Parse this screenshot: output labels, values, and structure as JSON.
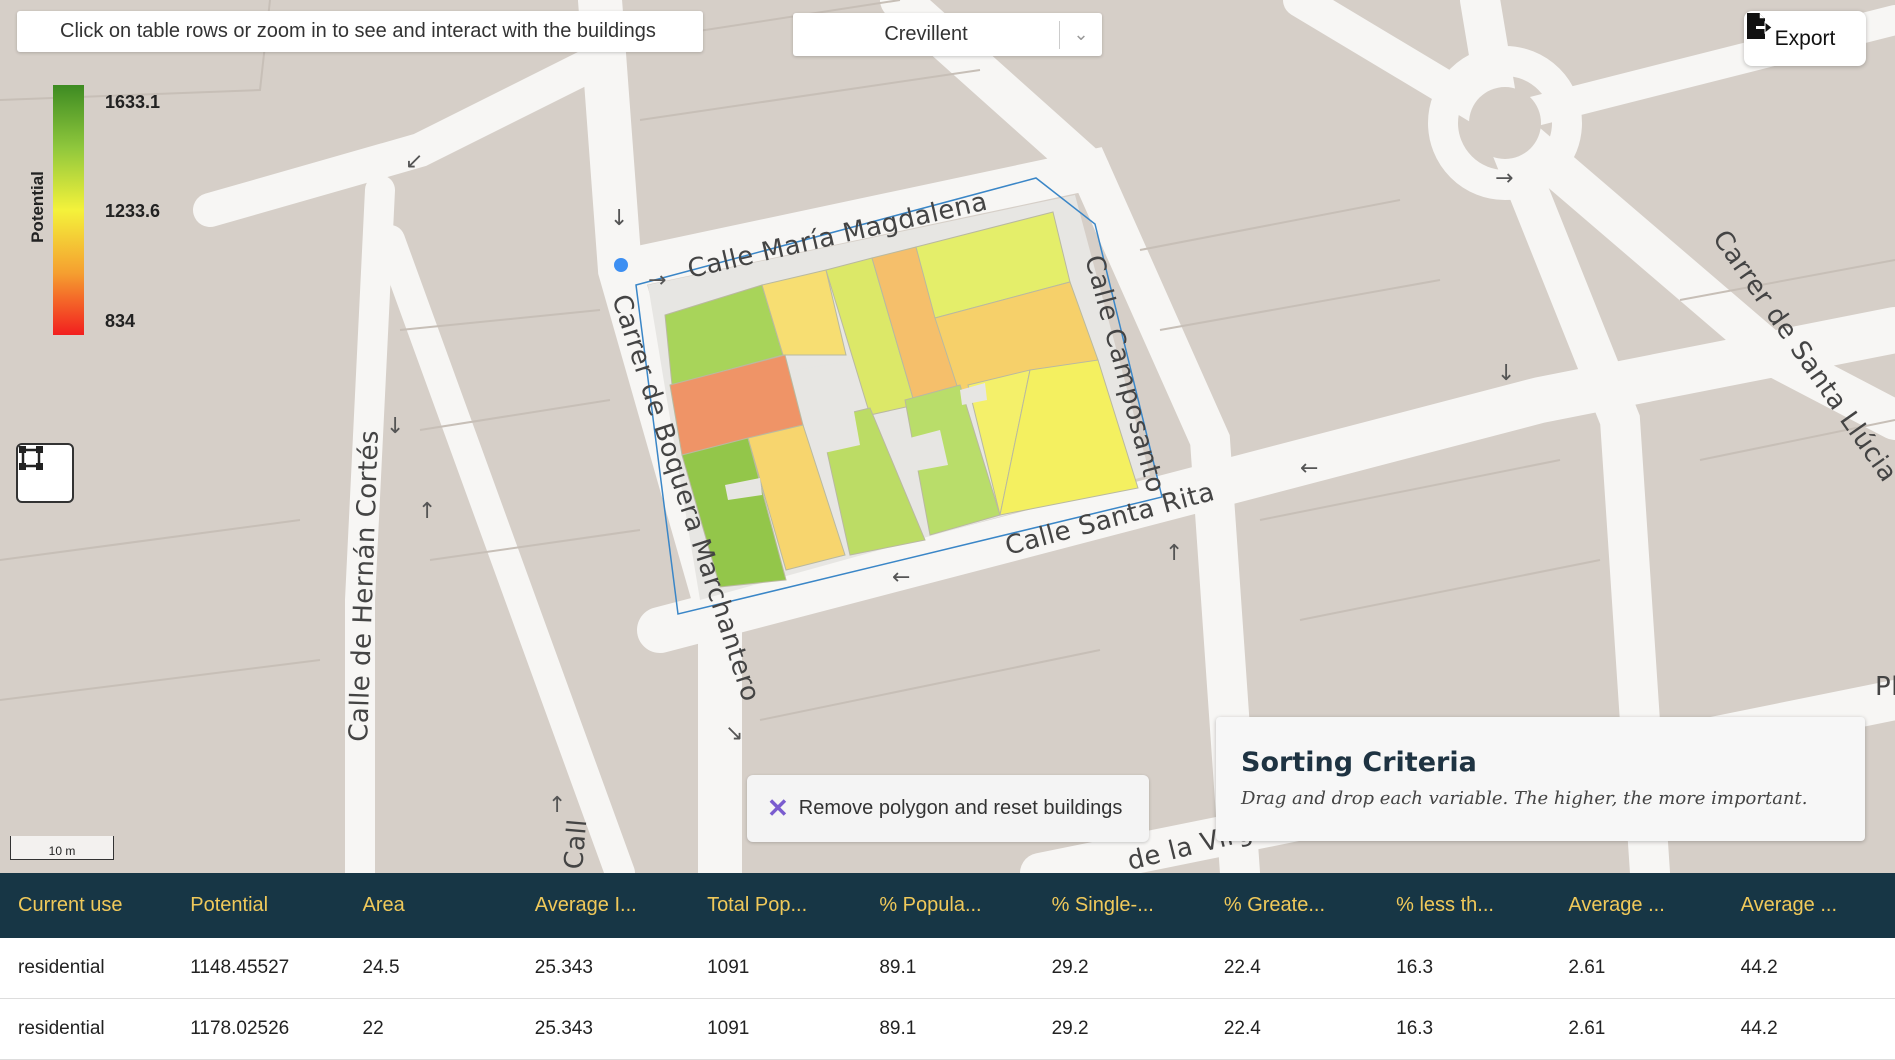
{
  "instruction": "Click on table rows or zoom in to see and interact with the buildings",
  "city_select": {
    "value": "Crevillent"
  },
  "export_label": "Export",
  "legend": {
    "title": "Potential",
    "max": "1633.1",
    "mid": "1233.6",
    "min": "834",
    "colors": [
      "#3d8b22",
      "#f4f23b",
      "#f21f1f"
    ]
  },
  "streets": [
    "Calle María Magdalena",
    "Calle Camposanto",
    "Carrer de Boquera Marchantero",
    "Calle Santa Rita",
    "Calle de Hernán Cortés",
    "Carrer de Santa Llúcia",
    "de la Virgen d",
    "Call",
    "Pl"
  ],
  "scale_label": "10 m",
  "remove_button": "Remove polygon and reset buildings",
  "sorting": {
    "title": "Sorting Criteria",
    "subtitle": "Drag and drop each variable. The higher, the more important."
  },
  "table": {
    "columns": [
      "Current use",
      "Potential",
      "Area",
      "Average I...",
      "Total Pop...",
      "% Popula...",
      "% Single-...",
      "% Greate...",
      "% less th...",
      "Average ...",
      "Average ..."
    ],
    "rows": [
      [
        "residential",
        "1148.45527",
        "24.5",
        "25.343",
        "1091",
        "89.1",
        "29.2",
        "22.4",
        "16.3",
        "2.61",
        "44.2"
      ],
      [
        "residential",
        "1178.02526",
        "22",
        "25.343",
        "1091",
        "89.1",
        "29.2",
        "22.4",
        "16.3",
        "2.61",
        "44.2"
      ]
    ]
  }
}
